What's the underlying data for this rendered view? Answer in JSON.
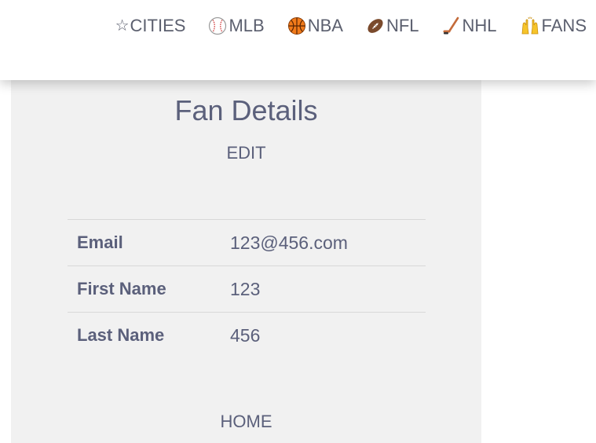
{
  "nav": {
    "items": [
      {
        "label": "CITIES",
        "icon": "star-icon"
      },
      {
        "label": "MLB",
        "icon": "baseball-icon"
      },
      {
        "label": "NBA",
        "icon": "basketball-icon"
      },
      {
        "label": "NFL",
        "icon": "football-icon"
      },
      {
        "label": "NHL",
        "icon": "hockey-icon"
      },
      {
        "label": "FANS",
        "icon": "raised-hands-icon"
      }
    ]
  },
  "page": {
    "title": "Fan Details",
    "edit_label": "EDIT",
    "home_label": "HOME"
  },
  "details": [
    {
      "label": "Email",
      "value": "123@456.com"
    },
    {
      "label": "First Name",
      "value": "123"
    },
    {
      "label": "Last Name",
      "value": "456"
    }
  ],
  "colors": {
    "text": "#5b607b",
    "panel_bg": "#f1f1f1",
    "divider": "#d8d8d8"
  }
}
